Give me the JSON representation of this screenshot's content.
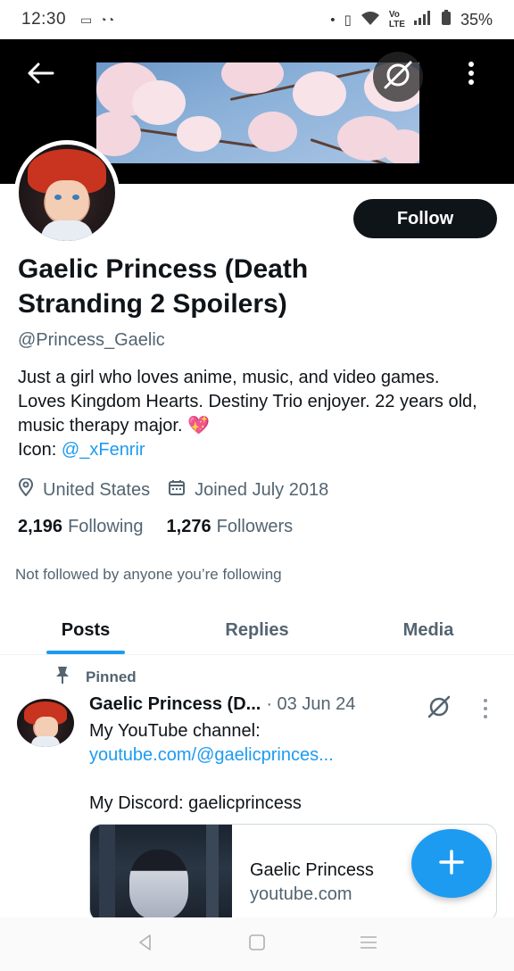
{
  "status_bar": {
    "time": "12:30",
    "battery": "35%"
  },
  "profile": {
    "display_name": "Gaelic Princess (Death Stranding 2 Spoilers)",
    "handle": "@Princess_Gaelic",
    "follow_label": "Follow",
    "bio_text": "Just a girl who loves anime, music, and video games. Loves Kingdom Hearts. Destiny Trio enjoyer. 22 years old, music therapy major. ",
    "bio_emoji": "💖",
    "bio_icon_prefix": "Icon: ",
    "bio_icon_link": "@_xFenrir",
    "location": "United States",
    "joined": "Joined July 2018",
    "following_count": "2,196",
    "following_label": "Following",
    "followers_count": "1,276",
    "followers_label": "Followers",
    "not_followed_text": "Not followed by anyone you’re following"
  },
  "tabs": [
    {
      "label": "Posts",
      "active": true
    },
    {
      "label": "Replies",
      "active": false
    },
    {
      "label": "Media",
      "active": false
    }
  ],
  "post": {
    "pinned_label": "Pinned",
    "author": "Gaelic Princess (D...",
    "date": "· 03 Jun 24",
    "line1": "My YouTube channel:",
    "link": "youtube.com/@gaelicprinces...",
    "line3": "My Discord: gaelicprincess",
    "card_title": "Gaelic Princess",
    "card_domain": "youtube.com"
  },
  "icons": {
    "back": "arrow-left-icon",
    "grok": "grok-icon",
    "more": "more-vertical-icon",
    "location": "location-pin-icon",
    "calendar": "calendar-icon",
    "pin": "pin-icon",
    "compose": "plus-icon"
  },
  "colors": {
    "accent": "#1d9bf0",
    "text": "#0f1419",
    "secondary": "#536471",
    "button_dark": "#0f1419"
  }
}
